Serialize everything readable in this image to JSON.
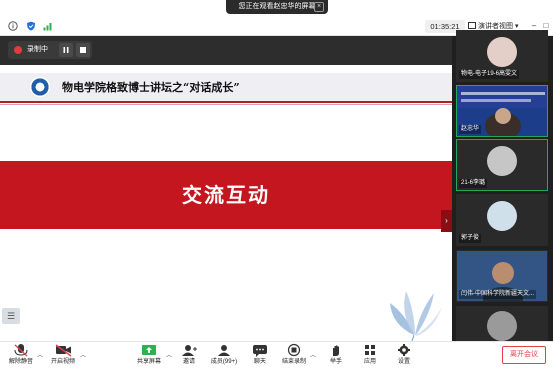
{
  "banner": {
    "text": "您正在观看赵忠华的屏幕",
    "close": "×"
  },
  "status": {
    "timer": "01:35:21",
    "view_label": "演讲者视图",
    "view_caret": "▾"
  },
  "window": {
    "minimize": "–",
    "maximize": "□",
    "close": "×"
  },
  "recording": {
    "label": "录制中"
  },
  "slide": {
    "title": "物电学院格致博士讲坛之“对话成长”",
    "band_text": "交流互动",
    "side_tab": "›",
    "menu_glyph": "☰"
  },
  "participants": [
    {
      "name": "物电-电子19-6高雯文"
    },
    {
      "name": "赵忠华"
    },
    {
      "name": "21-6李璐"
    },
    {
      "name": "郭子俊"
    },
    {
      "name": "闫伟-中国科学院新疆天文..."
    },
    {
      "name": ""
    }
  ],
  "toolbar": {
    "mute": "解除静音",
    "video": "开启视频",
    "share": "共享屏幕",
    "invite": "邀请",
    "members": "成员(99+)",
    "chat": "聊天",
    "end_record": "结束录制",
    "raise_hand": "举手",
    "apps": "应用",
    "settings": "设置",
    "leave": "离开会议"
  },
  "colors": {
    "accent_red": "#c4161f",
    "leave_red": "#e0424a",
    "active_green": "#23a85a"
  }
}
